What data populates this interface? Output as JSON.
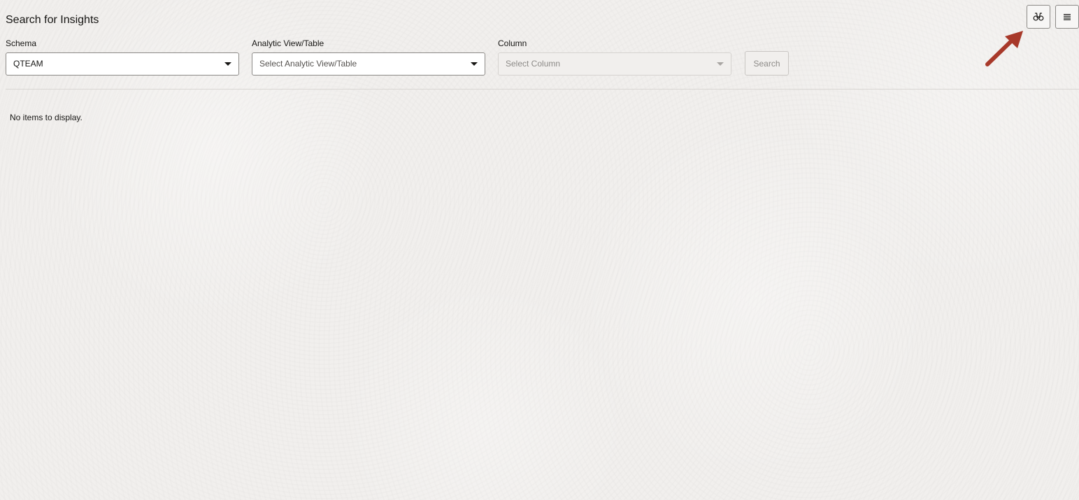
{
  "page": {
    "title": "Search for Insights"
  },
  "filters": {
    "schema": {
      "label": "Schema",
      "value": "QTEAM"
    },
    "analytic_view": {
      "label": "Analytic View/Table",
      "placeholder": "Select Analytic View/Table"
    },
    "column": {
      "label": "Column",
      "placeholder": "Select Column",
      "disabled": true
    },
    "search_label": "Search"
  },
  "results": {
    "empty_message": "No items to display."
  },
  "toolbar": {
    "insights_icon": "binoculars-icon",
    "menu_icon": "hamburger-menu-icon"
  },
  "colors": {
    "background": "#f1efed",
    "annotation_arrow": "#a8392a"
  }
}
